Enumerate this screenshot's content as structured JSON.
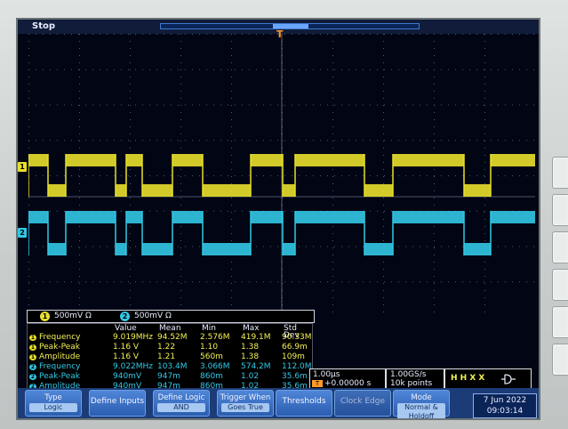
{
  "status": {
    "run_state": "Stop"
  },
  "trigger": {
    "marker": "T",
    "state_icon": "H H X X"
  },
  "channels": [
    {
      "id": "1",
      "label": "1",
      "scale": "500mV Ω",
      "color": "#e8e02a"
    },
    {
      "id": "2",
      "label": "2",
      "scale": "500mV Ω",
      "color": "#32c8e6"
    }
  ],
  "measurements": {
    "headers": [
      "Value",
      "Mean",
      "Min",
      "Max",
      "Std Dev"
    ],
    "rows": [
      {
        "ch": "1",
        "name": "Frequency",
        "value": "9.019MHz",
        "mean": "94.52M",
        "min": "2.576M",
        "max": "419.1M",
        "std": "90.33M"
      },
      {
        "ch": "1",
        "name": "Peak-Peak",
        "value": "1.16 V",
        "mean": "1.22",
        "min": "1.10",
        "max": "1.38",
        "std": "66.9m"
      },
      {
        "ch": "1",
        "name": "Amplitude",
        "value": "1.16 V",
        "mean": "1.21",
        "min": "560m",
        "max": "1.38",
        "std": "109m"
      },
      {
        "ch": "2",
        "name": "Frequency",
        "value": "9.022MHz",
        "mean": "103.4M",
        "min": "3.066M",
        "max": "574.2M",
        "std": "112.0M"
      },
      {
        "ch": "2",
        "name": "Peak-Peak",
        "value": "940mV",
        "mean": "947m",
        "min": "860m",
        "max": "1.02",
        "std": "35.6m"
      },
      {
        "ch": "2",
        "name": "Amplitude",
        "value": "940mV",
        "mean": "947m",
        "min": "860m",
        "max": "1.02",
        "std": "35.6m"
      }
    ]
  },
  "timebase": {
    "scale": "1.00µs",
    "position": "+0.00000 s"
  },
  "acquisition": {
    "rate": "1.00GS/s",
    "points": "10k points"
  },
  "menu": [
    {
      "label": "Type",
      "sub": "Logic"
    },
    {
      "label": "Define Inputs",
      "sub": ""
    },
    {
      "label": "Define Logic",
      "sub": "AND"
    },
    {
      "label": "Trigger When",
      "sub": "Goes True"
    },
    {
      "label": "Thresholds",
      "sub": ""
    },
    {
      "label": "Clock Edge",
      "sub": ""
    },
    {
      "label": "Mode",
      "sub": "Normal & Holdoff"
    }
  ],
  "datetime": {
    "date": "7 Jun 2022",
    "time": "09:03:14"
  }
}
